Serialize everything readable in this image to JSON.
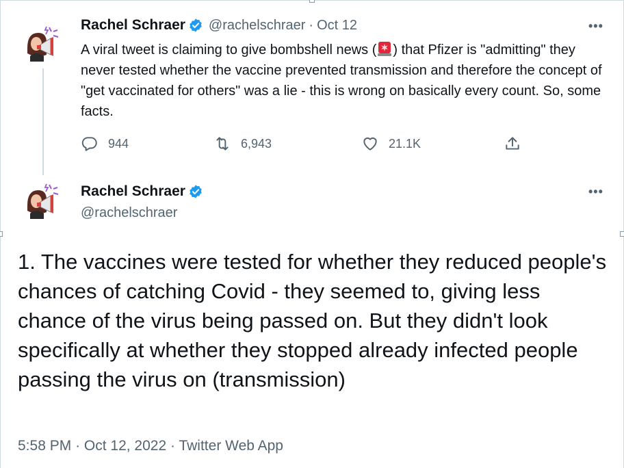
{
  "tweet1": {
    "name": "Rachel Schraer",
    "handle": "@rachelschraer",
    "separator": "·",
    "date": "Oct 12",
    "text_before_emoji": "A viral tweet is claiming to give bombshell news (",
    "text_after_emoji": ") that Pfizer is \"admitting\" they never tested whether the vaccine prevented transmission and therefore the concept of \"get vaccinated for others\" was a lie - this is wrong on basically every count. So, some facts.",
    "emoji": "siren-icon",
    "more": "•••",
    "actions": {
      "replies": "944",
      "retweets": "6,943",
      "likes": "21.1K"
    }
  },
  "tweet2": {
    "name": "Rachel Schraer",
    "handle": "@rachelschraer",
    "more": "•••",
    "text": "1. The vaccines were tested for whether they reduced people's chances of catching Covid - they seemed to, giving less chance of the virus being passed on. But they didn't look specifically at whether they stopped already infected people passing the virus on (transmission)",
    "time": "5:58 PM",
    "separator": "·",
    "date": "Oct 12, 2022",
    "source": "Twitter Web App"
  },
  "colors": {
    "text": "#0f1419",
    "secondary": "#536471",
    "verified": "#1d9bf0",
    "divider": "#cfd9de"
  }
}
